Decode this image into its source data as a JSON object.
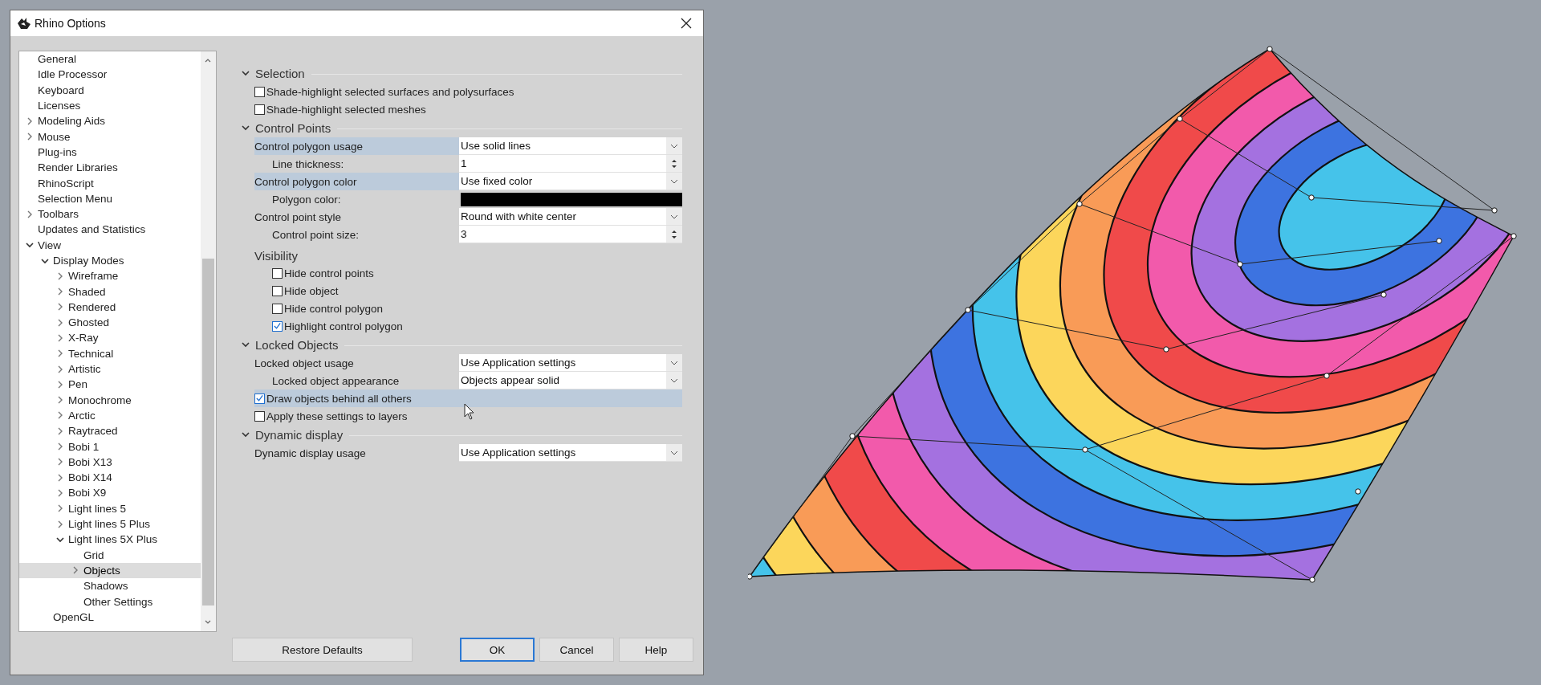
{
  "window": {
    "title": "Rhino Options"
  },
  "tree": {
    "items": [
      {
        "label": "General",
        "selected": false
      },
      {
        "label": "Idle Processor",
        "selected": false
      },
      {
        "label": "Keyboard",
        "selected": false
      },
      {
        "label": "Licenses",
        "selected": false
      },
      {
        "label": "Modeling Aids",
        "selected": false,
        "expanded": false
      },
      {
        "label": "Mouse",
        "selected": false,
        "expanded": false
      },
      {
        "label": "Plug-ins",
        "selected": false
      },
      {
        "label": "Render Libraries",
        "selected": false
      },
      {
        "label": "RhinoScript",
        "selected": false
      },
      {
        "label": "Selection Menu",
        "selected": false
      },
      {
        "label": "Toolbars",
        "selected": false,
        "expanded": false
      },
      {
        "label": "Updates and Statistics",
        "selected": false
      },
      {
        "label": "View",
        "selected": false,
        "expanded": true,
        "children": [
          {
            "label": "Display Modes",
            "selected": false,
            "expanded": true,
            "children": [
              {
                "label": "Wireframe",
                "selected": false,
                "expanded": false
              },
              {
                "label": "Shaded",
                "selected": false,
                "expanded": false
              },
              {
                "label": "Rendered",
                "selected": false,
                "expanded": false
              },
              {
                "label": "Ghosted",
                "selected": false,
                "expanded": false
              },
              {
                "label": "X-Ray",
                "selected": false,
                "expanded": false
              },
              {
                "label": "Technical",
                "selected": false,
                "expanded": false
              },
              {
                "label": "Artistic",
                "selected": false,
                "expanded": false
              },
              {
                "label": "Pen",
                "selected": false,
                "expanded": false
              },
              {
                "label": "Monochrome",
                "selected": false,
                "expanded": false
              },
              {
                "label": "Arctic",
                "selected": false,
                "expanded": false
              },
              {
                "label": "Raytraced",
                "selected": false,
                "expanded": false
              },
              {
                "label": "Bobi 1",
                "selected": false,
                "expanded": false
              },
              {
                "label": "Bobi X13",
                "selected": false,
                "expanded": false
              },
              {
                "label": "Bobi X14",
                "selected": false,
                "expanded": false
              },
              {
                "label": "Bobi X9",
                "selected": false,
                "expanded": false
              },
              {
                "label": "Light lines 5",
                "selected": false,
                "expanded": false
              },
              {
                "label": "Light lines 5 Plus",
                "selected": false,
                "expanded": false
              },
              {
                "label": "Light lines 5X Plus",
                "selected": false,
                "expanded": true,
                "children": [
                  {
                    "label": "Grid",
                    "selected": false
                  },
                  {
                    "label": "Objects",
                    "selected": true,
                    "expanded": false
                  },
                  {
                    "label": "Shadows",
                    "selected": false
                  },
                  {
                    "label": "Other Settings",
                    "selected": false
                  }
                ]
              }
            ]
          },
          {
            "label": "OpenGL",
            "selected": false
          }
        ]
      }
    ]
  },
  "sections": [
    {
      "title": "Selection",
      "expanded": true,
      "rows": [
        {
          "kind": "checkbox",
          "label": "Shade-highlight selected surfaces and polysurfaces",
          "checked": false,
          "highlighted": false
        },
        {
          "kind": "checkbox",
          "label": "Shade-highlight selected meshes",
          "checked": false,
          "highlighted": false
        }
      ]
    },
    {
      "title": "Control Points",
      "expanded": true,
      "rows": [
        {
          "kind": "dropdown",
          "label": "Control polygon usage",
          "value": "Use solid lines",
          "highlighted": true,
          "children": [
            {
              "kind": "spinner",
              "label": "Line thickness:",
              "value": "1",
              "highlighted": false
            }
          ]
        },
        {
          "kind": "dropdown",
          "label": "Control polygon color",
          "value": "Use fixed color",
          "highlighted": true,
          "children": [
            {
              "kind": "color",
              "label": "Polygon color:",
              "color": "#000000",
              "highlighted": false
            }
          ]
        },
        {
          "kind": "dropdown",
          "label": "Control point style",
          "value": "Round with white center",
          "highlighted": false,
          "children": [
            {
              "kind": "spinner",
              "label": "Control point size:",
              "value": "3",
              "highlighted": false
            }
          ]
        },
        {
          "kind": "group",
          "label": "Visibility",
          "children": [
            {
              "kind": "checkbox",
              "label": "Hide control points",
              "checked": false,
              "highlighted": false
            },
            {
              "kind": "checkbox",
              "label": "Hide object",
              "checked": false,
              "highlighted": false
            },
            {
              "kind": "checkbox",
              "label": "Hide control polygon",
              "checked": false,
              "highlighted": false
            },
            {
              "kind": "checkbox",
              "label": "Highlight control polygon",
              "checked": true,
              "highlighted": false
            }
          ]
        }
      ]
    },
    {
      "title": "Locked Objects",
      "expanded": true,
      "rows": [
        {
          "kind": "dropdown",
          "label": "Locked object usage",
          "value": "Use Application settings",
          "highlighted": false,
          "children": [
            {
              "kind": "dropdown",
              "label": "Locked object appearance",
              "value": "Objects appear solid",
              "highlighted": false
            }
          ]
        },
        {
          "kind": "checkbox",
          "label": "Draw objects behind all others",
          "checked": true,
          "highlighted": true
        },
        {
          "kind": "checkbox",
          "label": "Apply these settings to layers",
          "checked": false,
          "highlighted": false
        }
      ]
    },
    {
      "title": "Dynamic display",
      "expanded": true,
      "rows": [
        {
          "kind": "dropdown",
          "label": "Dynamic display usage",
          "value": "Use Application settings",
          "highlighted": false
        }
      ]
    }
  ],
  "restore_button": {
    "label": "Restore Defaults"
  },
  "buttons": [
    {
      "label": "OK",
      "default": true
    },
    {
      "label": "Cancel",
      "default": false
    },
    {
      "label": "Help",
      "default": false
    }
  ]
}
